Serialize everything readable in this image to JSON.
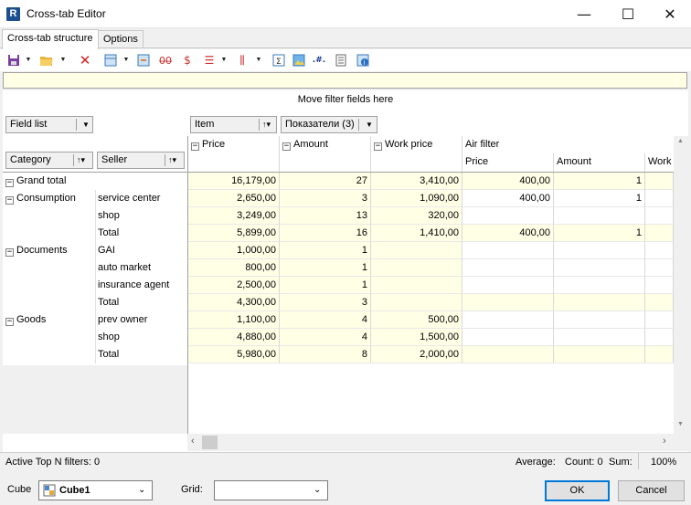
{
  "window": {
    "title": "Cross-tab Editor",
    "minimize": "—",
    "maximize": "☐",
    "close": "✕"
  },
  "tabs": [
    {
      "label": "Cross-tab structure"
    },
    {
      "label": "Options"
    }
  ],
  "filter_area": {
    "hint": "Move filter fields here"
  },
  "field_buttons": {
    "field_list": "Field list",
    "item": "Item",
    "indicators": "Показатели (3)",
    "category": "Category",
    "seller": "Seller"
  },
  "column_headers": {
    "price": "Price",
    "amount": "Amount",
    "work_price": "Work price",
    "air_filter": "Air filter",
    "sub_price": "Price",
    "sub_amount": "Amount",
    "sub_work": "Work"
  },
  "rows": [
    {
      "cat": "Grand total",
      "seller": "",
      "price": "16,179,00",
      "amount": "27",
      "work": "3,410,00",
      "af_price": "400,00",
      "af_amount": "1",
      "total": true
    },
    {
      "cat": "Consumption",
      "seller": "service center",
      "price": "2,650,00",
      "amount": "3",
      "work": "1,090,00",
      "af_price": "400,00",
      "af_amount": "1",
      "total": false
    },
    {
      "cat": "",
      "seller": "shop",
      "price": "3,249,00",
      "amount": "13",
      "work": "320,00",
      "af_price": "",
      "af_amount": "",
      "total": false
    },
    {
      "cat": "",
      "seller": "Total",
      "price": "5,899,00",
      "amount": "16",
      "work": "1,410,00",
      "af_price": "400,00",
      "af_amount": "1",
      "total": true
    },
    {
      "cat": "Documents",
      "seller": "GAI",
      "price": "1,000,00",
      "amount": "1",
      "work": "",
      "af_price": "",
      "af_amount": "",
      "total": false
    },
    {
      "cat": "",
      "seller": "auto market",
      "price": "800,00",
      "amount": "1",
      "work": "",
      "af_price": "",
      "af_amount": "",
      "total": false
    },
    {
      "cat": "",
      "seller": "insurance agent",
      "price": "2,500,00",
      "amount": "1",
      "work": "",
      "af_price": "",
      "af_amount": "",
      "total": false
    },
    {
      "cat": "",
      "seller": "Total",
      "price": "4,300,00",
      "amount": "3",
      "work": "",
      "af_price": "",
      "af_amount": "",
      "total": true
    },
    {
      "cat": "Goods",
      "seller": "prev owner",
      "price": "1,100,00",
      "amount": "4",
      "work": "500,00",
      "af_price": "",
      "af_amount": "",
      "total": false
    },
    {
      "cat": "",
      "seller": "shop",
      "price": "4,880,00",
      "amount": "4",
      "work": "1,500,00",
      "af_price": "",
      "af_amount": "",
      "total": false
    },
    {
      "cat": "",
      "seller": "Total",
      "price": "5,980,00",
      "amount": "8",
      "work": "2,000,00",
      "af_price": "",
      "af_amount": "",
      "total": true
    }
  ],
  "status": {
    "top_n": "Active Top N filters: 0",
    "average": "Average:",
    "count": "Count: 0",
    "sum": "Sum:",
    "zoom": "100%"
  },
  "bottom": {
    "cube_label": "Cube",
    "cube_value": "Cube1",
    "grid_label": "Grid:",
    "grid_value": "",
    "ok": "OK",
    "cancel": "Cancel"
  },
  "colors": {
    "total_bg": "#ffffe6",
    "accent": "#0078d7"
  }
}
